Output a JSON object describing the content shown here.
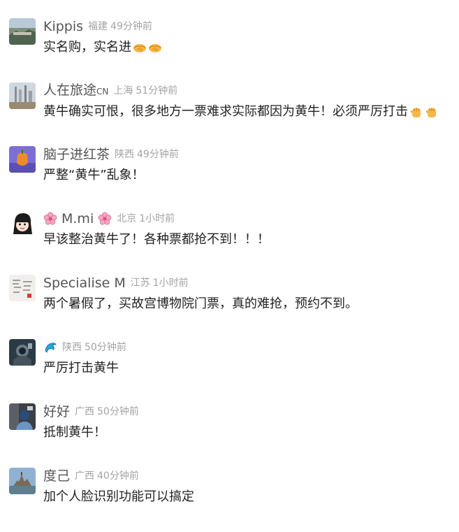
{
  "comments": [
    {
      "nick": "Kippis",
      "nick_suffix": "",
      "location": "福建",
      "time": "49分钟前",
      "text": "实名购，实名进",
      "text_emojis": [
        "handshake-emoji",
        "handshake-emoji"
      ]
    },
    {
      "nick": "人在旅途",
      "nick_suffix": "CN",
      "location": "上海",
      "time": "51分钟前",
      "text": "黄牛确实可恨，很多地方一票难求实际都因为黄牛！必须严厉打击",
      "text_emojis": [
        "raised-fist-emoji",
        "raised-fist-emoji"
      ]
    },
    {
      "nick": "脑子进红茶",
      "nick_suffix": "",
      "location": "陕西",
      "time": "49分钟前",
      "text": "严整“黄牛”乱象！",
      "text_emojis": []
    },
    {
      "nick": "M.mi",
      "nick_suffix": "",
      "location": "北京",
      "time": "1小时前",
      "text": "早该整治黄牛了！各种票都抢不到！！！",
      "text_emojis": []
    },
    {
      "nick": "Specialise M",
      "nick_suffix": "",
      "location": "江苏",
      "time": "1小时前",
      "text": "两个暑假了，买故宫博物院门票，真的难抢，预约不到。",
      "text_emojis": []
    },
    {
      "nick": "",
      "nick_suffix": "",
      "location": "陕西",
      "time": "50分钟前",
      "text": "严厉打击黄牛",
      "text_emojis": []
    },
    {
      "nick": "好好",
      "nick_suffix": "",
      "location": "广西",
      "time": "50分钟前",
      "text": "抵制黄牛！",
      "text_emojis": []
    },
    {
      "nick": "度己",
      "nick_suffix": "",
      "location": "广西",
      "time": "40分钟前",
      "text": "加个人脸识别功能可以搞定",
      "text_emojis": []
    }
  ],
  "icons": {
    "nick_flower": "cherry-blossom-icon",
    "nick_dolphin": "dolphin-icon"
  }
}
